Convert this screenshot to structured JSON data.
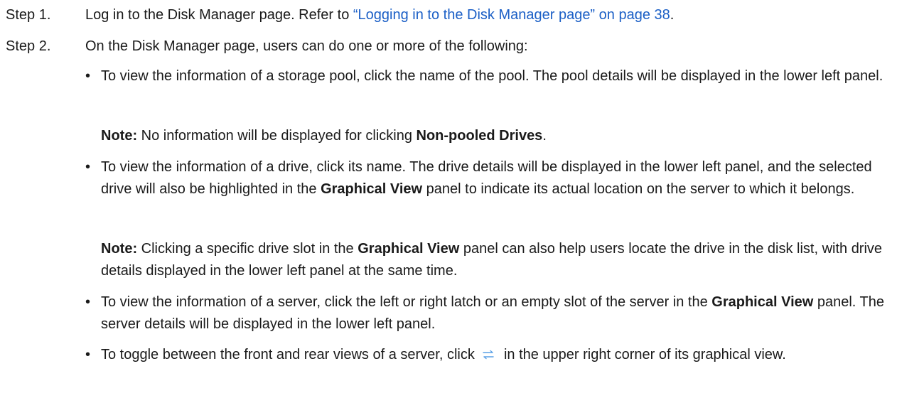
{
  "steps": [
    {
      "label": "Step 1.",
      "text_before": "Log in to the Disk Manager page. Refer to ",
      "link": "“Logging in to the Disk Manager page” on page 38",
      "text_after": "."
    },
    {
      "label": "Step 2.",
      "text": "On the Disk Manager page, users can do one or more of the following:"
    }
  ],
  "bullets": {
    "b1": {
      "text": "To view the information of a storage pool, click the name of the pool. The pool details will be displayed in the lower left panel.",
      "note_label": "Note:",
      "note_text_before": " No information will be displayed for clicking ",
      "note_bold": "Non-pooled Drives",
      "note_text_after": "."
    },
    "b2": {
      "text_before": "To view the information of a drive, click its name. The drive details will be displayed in the lower left panel, and the selected drive will also be highlighted in the ",
      "bold": "Graphical View",
      "text_after": " panel to indicate its actual location on the server to which it belongs.",
      "note_label": "Note:",
      "note_text_before": " Clicking a specific drive slot in the ",
      "note_bold": "Graphical View",
      "note_text_after": " panel can also help users locate the drive in the disk list, with drive details displayed in the lower left panel at the same time."
    },
    "b3": {
      "text_before": "To view the information of a server, click the left or right latch or an empty slot of the server in the ",
      "bold": "Graphical View",
      "text_after": " panel. The server details will be displayed in the lower left panel."
    },
    "b4": {
      "text_before": "To toggle between the front and rear views of a server, click ",
      "icon": "toggle-arrows-icon",
      "text_after": " in the upper right corner of its graphical view."
    },
    "bullet_char": "•"
  },
  "colors": {
    "link": "#1b5fc6",
    "text": "#1a1a1a",
    "icon": "#5aa0e6"
  }
}
